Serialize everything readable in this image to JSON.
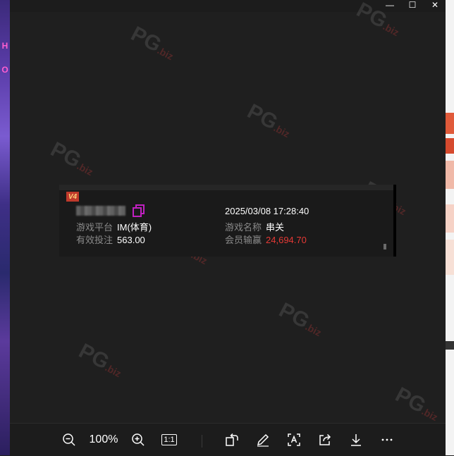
{
  "titlebar": {
    "buttons": [
      "—",
      "☐",
      "✕"
    ]
  },
  "record": {
    "vip_label": "V4",
    "date": "2025/03/08 17:28:40",
    "fields": [
      {
        "label": "游戏平台",
        "value": "IM(体育)"
      },
      {
        "label": "游戏名称",
        "value": "串关"
      },
      {
        "label": "有效投注",
        "value": "563.00"
      },
      {
        "label": "会员输赢",
        "value": "24,694.70"
      }
    ],
    "colors": {
      "loss_win": "#e53935",
      "copy_icon": "#c020c0"
    }
  },
  "watermark": {
    "text": "PG",
    "suffix": ".biz"
  },
  "toolbar": {
    "zoom_level": "100%",
    "icons": [
      "zoom-out-icon",
      "zoom-in-icon",
      "actual-size-icon",
      "rotate-icon",
      "edit-icon",
      "text-recognize-icon",
      "share-icon",
      "download-icon",
      "more-icon"
    ],
    "actual_size_label": "1:1"
  }
}
